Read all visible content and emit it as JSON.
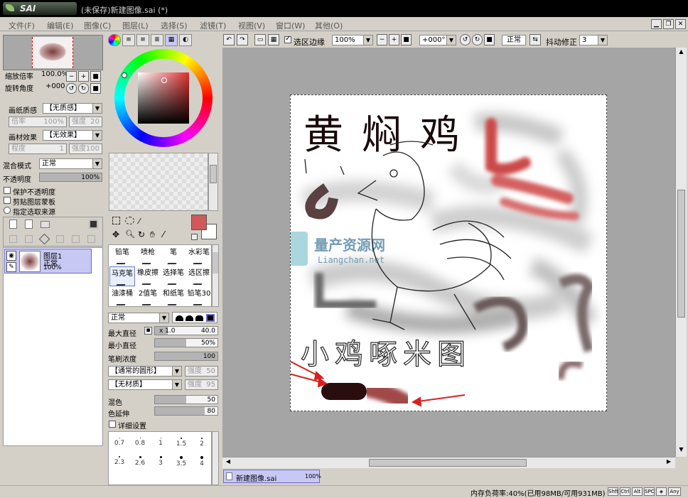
{
  "titlebar": {
    "app_logo": "SAI",
    "window_title": "(未保存)新建图像.sai (*)"
  },
  "menu": [
    "文件(F)",
    "编辑(E)",
    "图像(C)",
    "图层(L)",
    "选择(S)",
    "滤镜(T)",
    "视图(V)",
    "窗口(W)",
    "其他(O)"
  ],
  "window_buttons": [
    "▁",
    "❐",
    "✕"
  ],
  "navigator": {
    "zoom_label": "缩放倍率",
    "zoom_value": "100.0%",
    "rotate_label": "旋转角度",
    "rotate_value": "+000"
  },
  "paper": {
    "texture_label": "画纸质感",
    "texture_value": "【无质感】",
    "scale_label": "倍率",
    "scale_value": "100%",
    "strength_label": "强度",
    "strength_value": "20",
    "effect_label": "画材效果",
    "effect_value": "【无效果】",
    "degree_label": "程度",
    "degree_value": "1",
    "strength2_label": "强度",
    "strength2_value": "100"
  },
  "layer_props": {
    "blend_label": "混合模式",
    "blend_value": "正常",
    "opacity_label": "不透明度",
    "opacity_value": "100%",
    "protect_label": "保护不透明度",
    "clip_label": "剪贴图层蒙板",
    "source_label": "指定选取来源"
  },
  "layer": {
    "name": "图层1",
    "mode": "正常",
    "opacity": "100%"
  },
  "tools": [
    {
      "label": "铅笔",
      "active": false
    },
    {
      "label": "喷枪",
      "active": false
    },
    {
      "label": "笔",
      "active": false
    },
    {
      "label": "水彩笔",
      "active": false
    },
    {
      "label": "马克笔",
      "active": true
    },
    {
      "label": "橡皮擦",
      "active": false
    },
    {
      "label": "选择笔",
      "active": false
    },
    {
      "label": "选区擦",
      "active": false
    },
    {
      "label": "油漆桶",
      "active": false
    },
    {
      "label": "2值笔",
      "active": false
    },
    {
      "label": "和纸笔",
      "active": false
    },
    {
      "label": "铅笔30",
      "active": false
    }
  ],
  "brush": {
    "mode_value": "正常",
    "max_size_label": "最大直径",
    "max_size_mult": "x 1.0",
    "max_size_value": "40.0",
    "min_size_label": "最小直径",
    "min_size_value": "50%",
    "min_size_fill": 0.5,
    "density_label": "笔刷浓度",
    "density_value": "100",
    "density_fill": 1.0,
    "shape_value": "【通常的圆形】",
    "shape_strength_label": "强度",
    "shape_strength_value": "50",
    "texture_value": "【无材质】",
    "texture_strength_label": "强度",
    "texture_strength_value": "95",
    "blend_label": "混色",
    "blend_value": "50",
    "blend_fill": 0.5,
    "dilution_label": "色延伸",
    "dilution_value": "80",
    "dilution_fill": 0.8,
    "detail_label": "详细设置",
    "sizes": [
      "0.7",
      "0.8",
      "1",
      "1.5",
      "2",
      "2.3",
      "2.6",
      "3",
      "3.5",
      "4"
    ]
  },
  "colors": {
    "primary": "#d05a5a",
    "secondary": "#ffffff",
    "wheel_center": "#c84848"
  },
  "toolbar": {
    "selection_edge_label": "选区边缘",
    "zoom_value": "100%",
    "angle_value": "+000°",
    "mode_value": "正常",
    "stabilizer_label": "抖动修正",
    "stabilizer_value": "3"
  },
  "canvas": {
    "title_text": "黄焖鸡",
    "caption_text": "小鸡啄米图",
    "watermark_title": "量产资源网",
    "watermark_url": "Liangchan.net"
  },
  "tab": {
    "name": "新建图像.sai",
    "zoom": "100%"
  },
  "status": {
    "memory": "内存负荷率:40%(已用98MB/可用931MB)",
    "keys": [
      "Shft",
      "Ctrl",
      "Alt",
      "SPC",
      "◈",
      "Any"
    ]
  }
}
